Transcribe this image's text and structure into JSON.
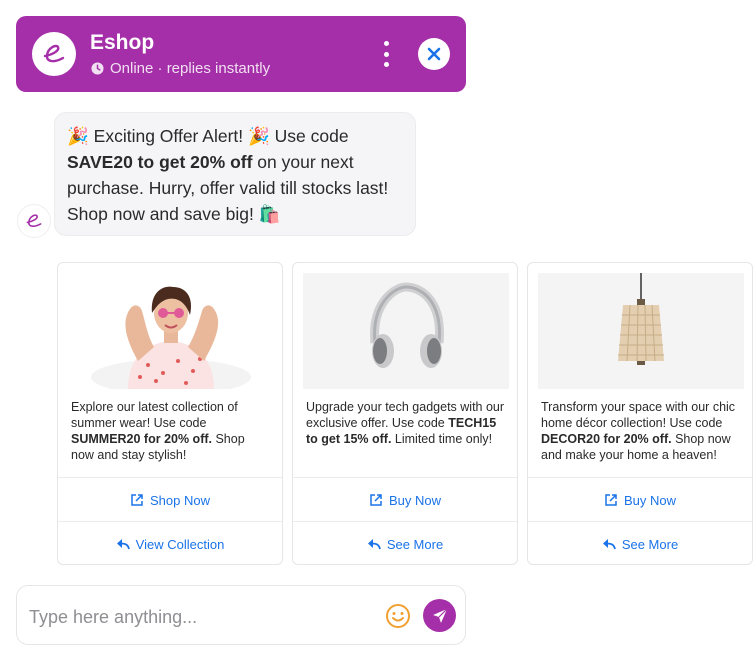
{
  "header": {
    "title": "Eshop",
    "status": "Online · replies instantly",
    "brand_color": "#a52fa8"
  },
  "message": {
    "emoji_start": "🎉",
    "part1": " Exciting Offer Alert! ",
    "emoji_mid": "🎉",
    "part2": " Use code ",
    "bold": "SAVE20 to get 20% off",
    "part3": " on your next purchase. Hurry, offer valid till stocks last! Shop now and save big! ",
    "emoji_end": "🛍️"
  },
  "cards": [
    {
      "desc_pre": "Explore our latest collection of summer wear! Use code ",
      "desc_bold": "SUMMER20 for 20% off.",
      "desc_post": " Shop now and stay stylish!",
      "action1": "Shop Now",
      "action2": "View Collection"
    },
    {
      "desc_pre": "Upgrade your tech gadgets with our exclusive offer. Use code ",
      "desc_bold": "TECH15 to get 15% off.",
      "desc_post": " Limited time only!",
      "action1": "Buy Now",
      "action2": "See More"
    },
    {
      "desc_pre": "Transform your space with our chic home décor collection! Use code ",
      "desc_bold": "DECOR20 for 20% off.",
      "desc_post": " Shop now and make your home a heaven!",
      "action1": "Buy Now",
      "action2": "See More"
    }
  ],
  "composer": {
    "placeholder": "Type here anything..."
  },
  "icons": {
    "logo": "eshop-logo",
    "status": "clock-icon",
    "menu": "kebab-menu-icon",
    "close": "close-icon",
    "open": "external-link-icon",
    "reply": "reply-arrow-icon",
    "emoji": "smiley-icon",
    "send": "send-icon"
  }
}
